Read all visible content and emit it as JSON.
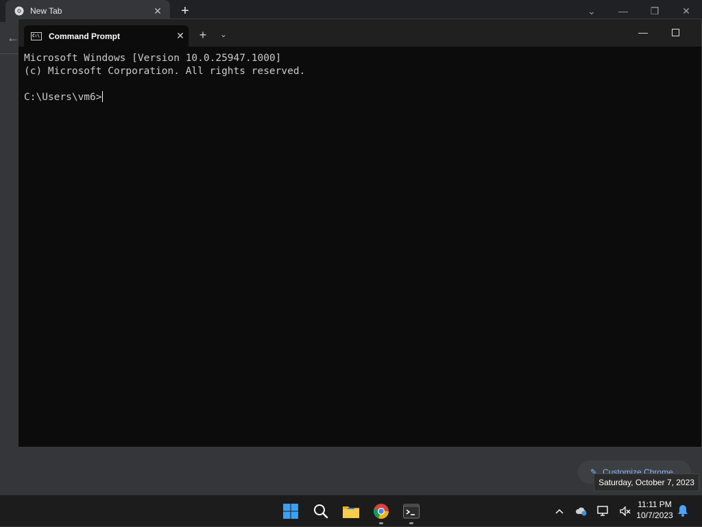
{
  "chrome": {
    "tab_title": "New Tab",
    "customize_label": "Customize Chrome"
  },
  "terminal": {
    "tab_label": "Command Prompt",
    "lines": [
      "Microsoft Windows [Version 10.0.25947.1000]",
      "(c) Microsoft Corporation. All rights reserved.",
      "",
      "C:\\Users\\vm6>"
    ]
  },
  "taskbar": {
    "apps": [
      "start-icon",
      "search-icon",
      "file-explorer-icon",
      "chrome-icon",
      "terminal-icon"
    ],
    "tray_icons": [
      "chevron-up-icon",
      "onedrive-icon",
      "network-icon",
      "volume-muted-icon"
    ],
    "time": "11:11 PM",
    "date": "10/7/2023",
    "tooltip": "Saturday, October 7, 2023"
  },
  "colors": {
    "terminal_bg": "#0c0c0c",
    "terminal_text": "#cccccc",
    "chrome_bg": "#35363a",
    "taskbar_bg": "#1c1c1c"
  }
}
